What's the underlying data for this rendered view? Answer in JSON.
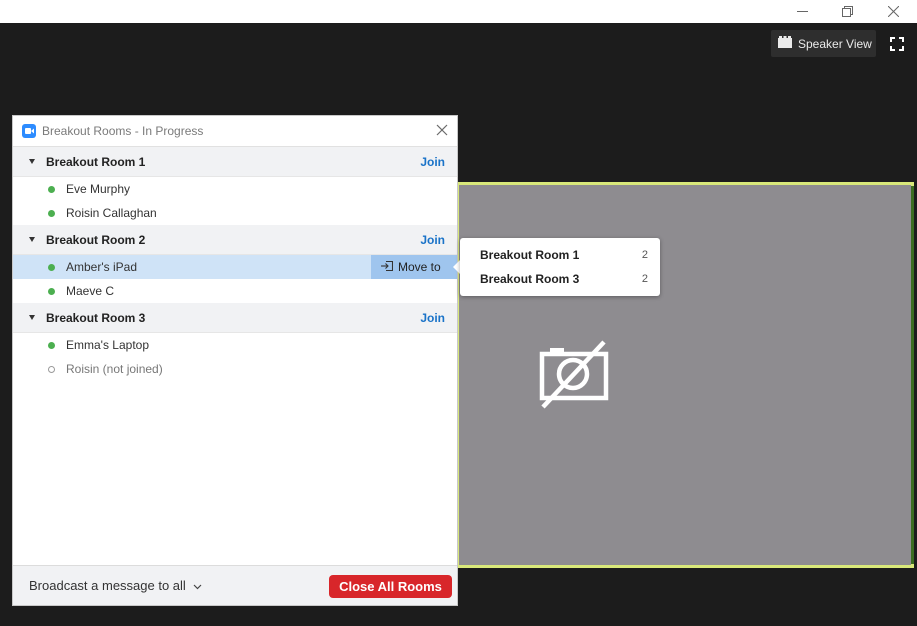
{
  "colors": {
    "accent": "#1a73c8",
    "danger": "#d8262a",
    "online": "#4caf50",
    "video_border": "#d9e87a",
    "selected_row": "#cfe3f7"
  },
  "window": {
    "minimize_icon": "minimize-icon",
    "restore_icon": "restore-icon",
    "close_icon": "close-icon"
  },
  "meeting": {
    "speaker_view_label": "Speaker View",
    "video_state_icon": "video-off-icon"
  },
  "panel": {
    "title": "Breakout Rooms - In Progress",
    "rooms": [
      {
        "name": "Breakout Room 1",
        "join_label": "Join",
        "participants": [
          {
            "name": "Eve Murphy",
            "joined": true
          },
          {
            "name": "Roisin Callaghan",
            "joined": true
          }
        ]
      },
      {
        "name": "Breakout Room 2",
        "join_label": "Join",
        "participants": [
          {
            "name": "Amber's iPad",
            "joined": true,
            "selected": true,
            "action_label": "Move to"
          },
          {
            "name": "Maeve C",
            "joined": true
          }
        ]
      },
      {
        "name": "Breakout Room 3",
        "join_label": "Join",
        "participants": [
          {
            "name": "Emma's Laptop",
            "joined": true
          },
          {
            "name": "Roisin (not joined)",
            "joined": false
          }
        ]
      }
    ],
    "footer": {
      "broadcast_label": "Broadcast a message to all",
      "close_all_label": "Close All Rooms"
    }
  },
  "move_to_menu": {
    "items": [
      {
        "name": "Breakout Room 1",
        "count": "2"
      },
      {
        "name": "Breakout Room 3",
        "count": "2"
      }
    ]
  }
}
